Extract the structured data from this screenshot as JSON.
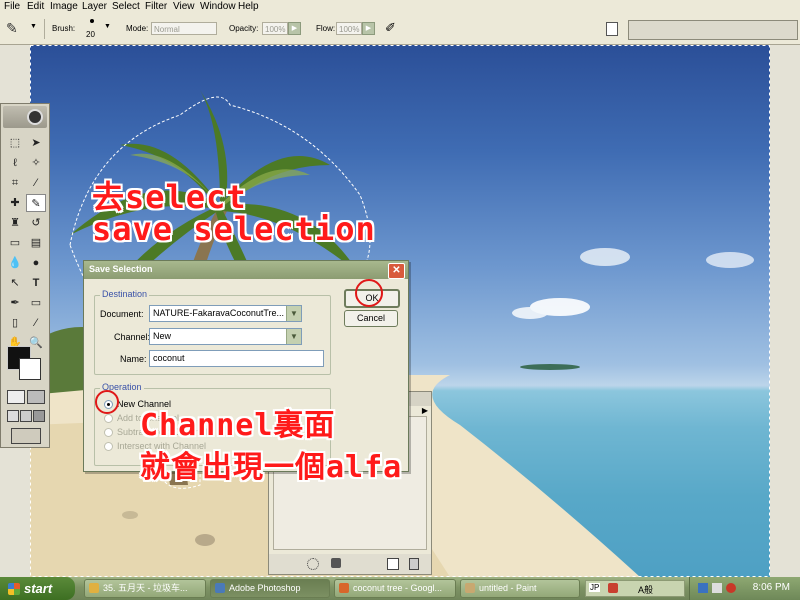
{
  "menu": [
    "File",
    "Edit",
    "Image",
    "Layer",
    "Select",
    "Filter",
    "View",
    "Window",
    "Help"
  ],
  "options_bar": {
    "brush_label": "Brush:",
    "brush_size": "20",
    "mode_label": "Mode:",
    "mode_value": "Normal",
    "opacity_label": "Opacity:",
    "opacity_value": "100%",
    "flow_label": "Flow:",
    "flow_value": "100%"
  },
  "annotations": {
    "line1": "去select",
    "line2": "save selection",
    "line3": "Channel裏面",
    "line4": "就會出現一個alfa"
  },
  "dialog": {
    "title": "Save Selection",
    "close": "✕",
    "destination_label": "Destination",
    "document_label": "Document:",
    "document_value": "NATURE-FakaravaCoconutTre...",
    "channel_label": "Channel:",
    "channel_value": "New",
    "name_label": "Name:",
    "name_value": "coconut",
    "operation_label": "Operation",
    "op_new": "New Channel",
    "op_add": "Add to Channel",
    "op_sub": "Subtract from Channel",
    "op_int": "Intersect with Channel",
    "ok": "OK",
    "cancel": "Cancel"
  },
  "taskbar": {
    "start": "start",
    "tasks": [
      "35. 五月天 - 垃圾车...",
      "Adobe Photoshop",
      "coconut tree - Googl...",
      "untitled - Paint"
    ],
    "clock": "8:06 PM",
    "lang": "JP",
    "ime": "A般"
  },
  "colors": {
    "annotation": "#ff1a1a",
    "title_bar": "#8c9c72",
    "taskbar": "#7e9364"
  },
  "icons": [
    "brush-icon",
    "move-icon",
    "marquee-icon",
    "lasso-icon",
    "crop-icon",
    "type-icon",
    "hand-icon",
    "zoom-icon",
    "start-logo-icon"
  ]
}
